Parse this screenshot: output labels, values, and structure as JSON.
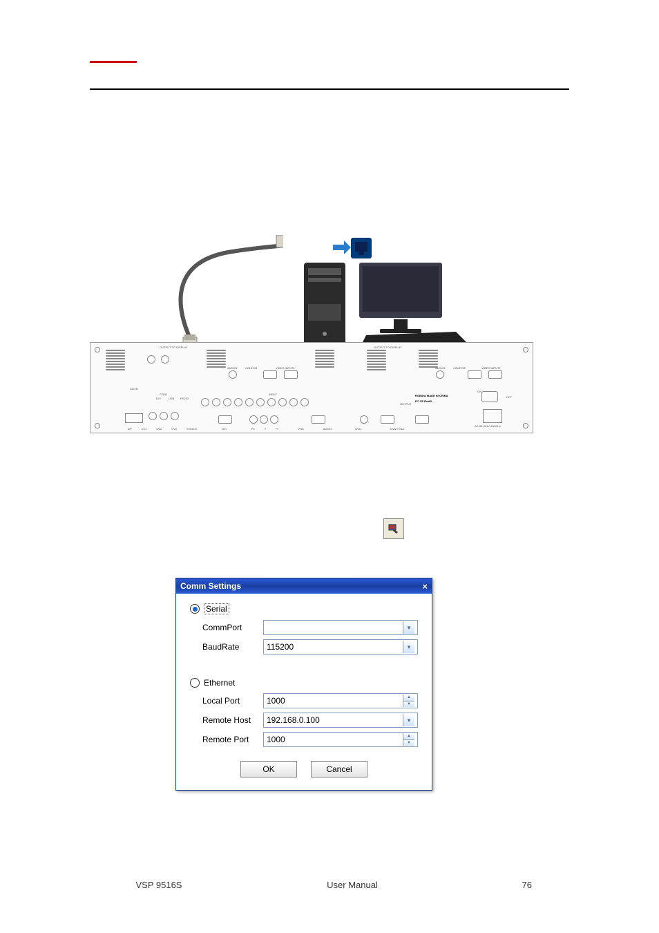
{
  "dialog": {
    "title": "Comm Settings",
    "close": "×",
    "serial_label": "Serial",
    "commport_label": "CommPort",
    "commport_value": "",
    "baudrate_label": "BaudRate",
    "baudrate_value": "115200",
    "ethernet_label": "Ethernet",
    "localport_label": "Local Port",
    "localport_value": "1000",
    "remotehost_label": "Remote Host",
    "remotehost_value": "192.168.0.100",
    "remoteport_label": "Remote Port",
    "remoteport_value": "1000",
    "ok_label": "OK",
    "cancel_label": "Cancel"
  },
  "panel": {
    "output1": "OUTPUT TO DISPLAY",
    "output2": "OUTPUT TO DISPLAY",
    "audio1": "AUDIO1",
    "config1": "CONFIG1",
    "video_input1": "VIDEO INPUT1",
    "audio2": "AUDIO2",
    "config2": "CONFIG2",
    "video_input2": "VIDEO INPUT2",
    "input": "INPUT",
    "output": "OUTPUT",
    "con1": "CON1",
    "sdi_in": "SDI IN",
    "usb": "USB",
    "rs232": "RS232",
    "dvi": "DVI",
    "made": "RGBlink MADE IN CHINA",
    "rohs": "FC CE RoHS",
    "on": "ON",
    "off": "OFF",
    "ac": "AC 85-264V 50/60Hz",
    "bottom_labels": [
      "DP",
      "CV1",
      "CV2",
      "CV3",
      "SVIDEO",
      "DVI",
      "Pb",
      "Y",
      "Pr",
      "VGA",
      "AUDIO",
      "DVI1",
      "DVI2+VGA"
    ]
  },
  "footer": {
    "model": "VSP 9516S",
    "title": "User Manual",
    "page": "76"
  }
}
